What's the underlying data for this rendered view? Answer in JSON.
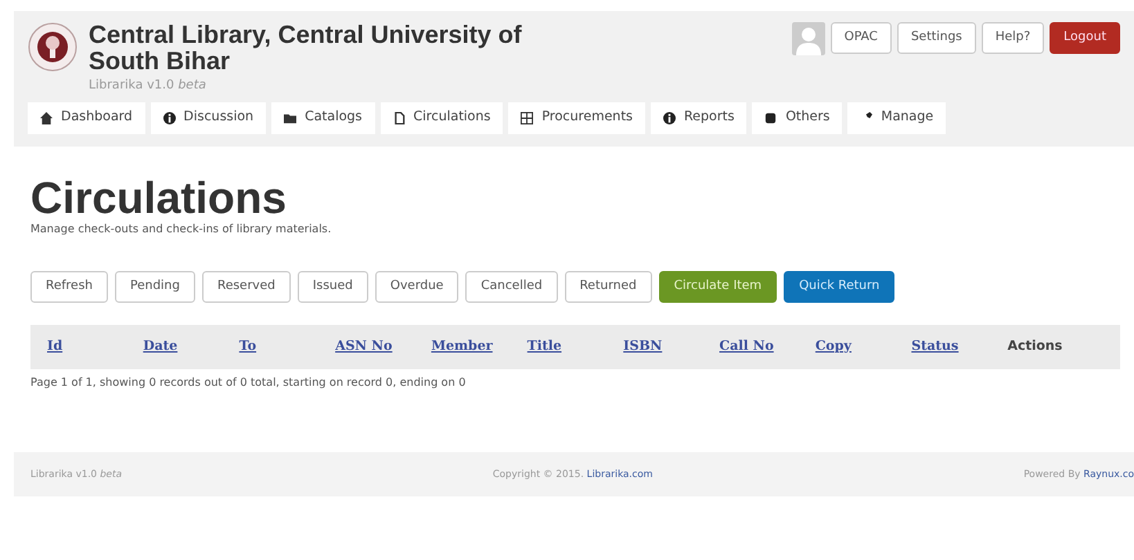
{
  "header": {
    "title": "Central Library, Central University of South Bihar",
    "version": "Librarika v1.0 *beta*",
    "top_buttons": [
      {
        "label": "OPAC",
        "kind": "default"
      },
      {
        "label": "Settings",
        "kind": "default"
      },
      {
        "label": "Help?",
        "kind": "default"
      },
      {
        "label": "Logout",
        "kind": "danger"
      }
    ],
    "nav": [
      {
        "label": "Dashboard"
      },
      {
        "label": "Discussion"
      },
      {
        "label": "Catalogs"
      },
      {
        "label": "Circulations"
      },
      {
        "label": "Procurements"
      },
      {
        "label": "Reports"
      },
      {
        "label": "Others"
      },
      {
        "label": "Manage"
      }
    ]
  },
  "page": {
    "title": "Circulations",
    "subtitle": "Manage check-outs and check-ins of library materials."
  },
  "actions": [
    {
      "label": "Refresh",
      "kind": "default"
    },
    {
      "label": "Pending",
      "kind": "default"
    },
    {
      "label": "Reserved",
      "kind": "default"
    },
    {
      "label": "Issued",
      "kind": "default"
    },
    {
      "label": "Overdue",
      "kind": "default"
    },
    {
      "label": "Cancelled",
      "kind": "default"
    },
    {
      "label": "Returned",
      "kind": "default"
    },
    {
      "label": "Circulate Item",
      "kind": "success"
    },
    {
      "label": "Quick Return",
      "kind": "primary"
    }
  ],
  "table": {
    "columns": [
      {
        "label": "Id",
        "kind": "sort"
      },
      {
        "label": "Date",
        "kind": "sort"
      },
      {
        "label": "To",
        "kind": "sort"
      },
      {
        "label": "ASN No",
        "kind": "sort"
      },
      {
        "label": "Member",
        "kind": "sort"
      },
      {
        "label": "Title",
        "kind": "sort"
      },
      {
        "label": "ISBN",
        "kind": "sort"
      },
      {
        "label": "Call No",
        "kind": "sort"
      },
      {
        "label": "Copy",
        "kind": "sort"
      },
      {
        "label": "Status",
        "kind": "sort"
      },
      {
        "label": "Actions",
        "kind": "plain"
      }
    ],
    "paging": "Page 1 of 1, showing 0 records out of 0 total, starting on record 0, ending on 0"
  },
  "footer": {
    "left": "Librarika v1.0 *beta*",
    "copyright": "Copyright © 2015. ",
    "copyright_link": "Librarika.com",
    "powered": "Powered By ",
    "powered_link": "Raynux.co"
  }
}
